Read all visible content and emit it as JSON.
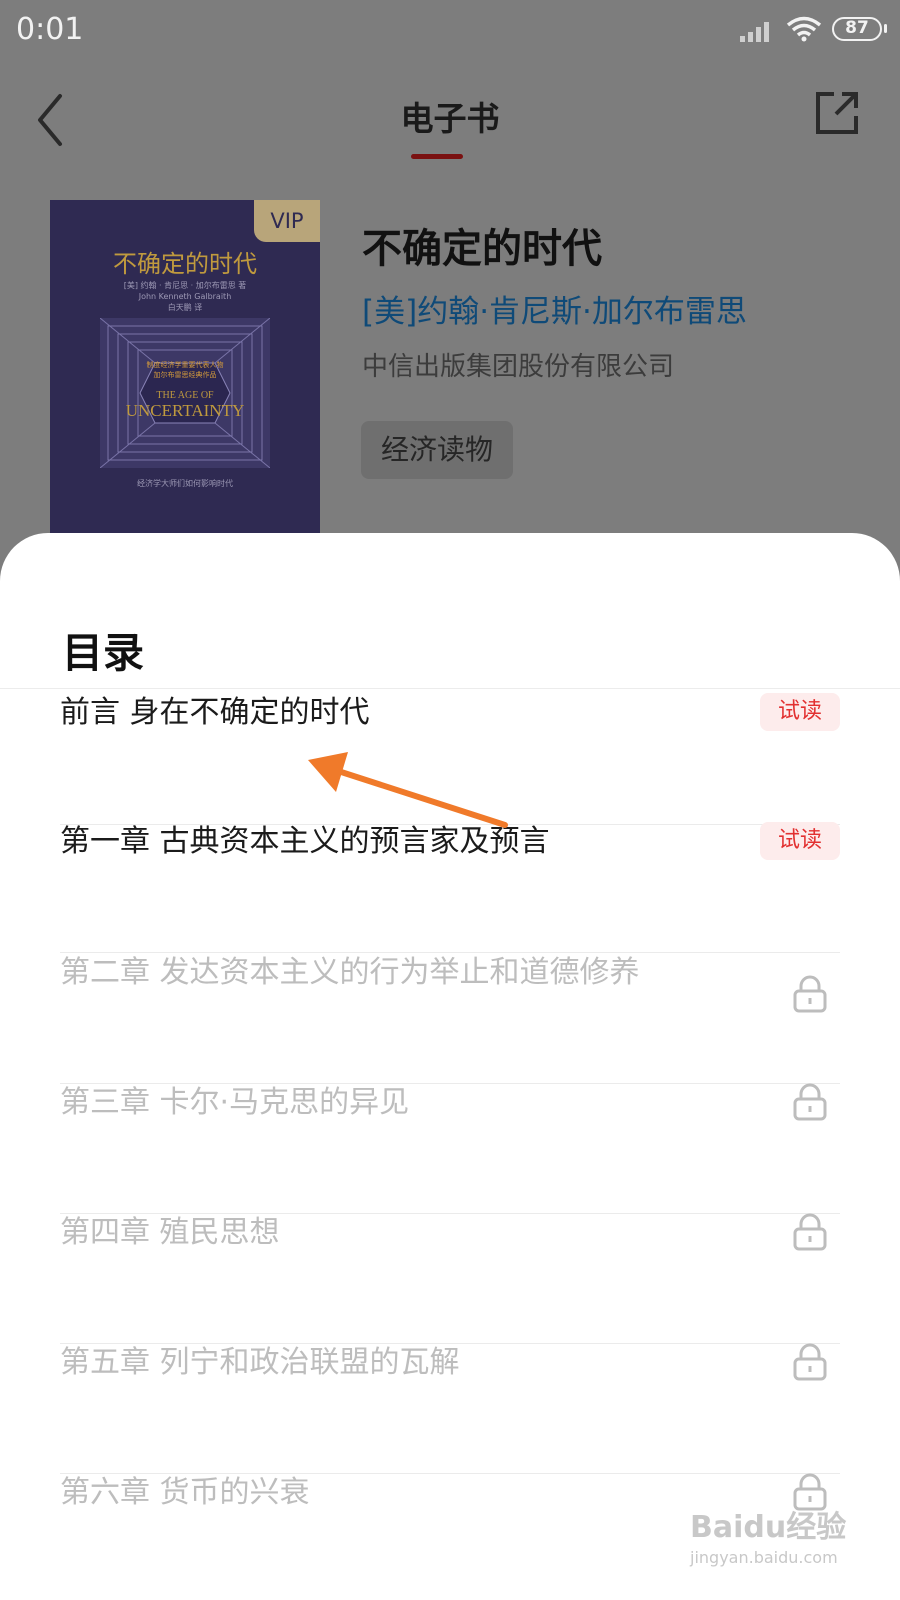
{
  "status_bar": {
    "time": "0:01",
    "battery": "87"
  },
  "header": {
    "title": "电子书"
  },
  "book": {
    "title": "不确定的时代",
    "author": "[美]约翰·肯尼斯·加尔布雷思",
    "publisher": "中信出版集团股份有限公司",
    "tag": "经济读物",
    "cover": {
      "vip_badge": "VIP",
      "title": "不确定的时代",
      "author_line": "[美] 约翰 · 肯尼思 · 加尔布雷思 著",
      "author_en": "John Kenneth Galbraith",
      "translator": "白天鹏 译",
      "tagline_1": "制度经济学重要代表人物",
      "tagline_2": "加尔布雷思经典作品",
      "english_title_1": "THE AGE OF",
      "english_title_2": "UNCERTAINTY",
      "footer": "经济学大师们如何影响时代"
    }
  },
  "toc": {
    "title": "目录",
    "trial_label": "试读",
    "items": [
      {
        "label": "前言 身在不确定的时代",
        "state": "trial"
      },
      {
        "label": "第一章 古典资本主义的预言家及预言",
        "state": "trial"
      },
      {
        "label": "第二章 发达资本主义的行为举止和道德修养",
        "state": "locked"
      },
      {
        "label": "第三章 卡尔·马克思的异见",
        "state": "locked"
      },
      {
        "label": "第四章 殖民思想",
        "state": "locked"
      },
      {
        "label": "第五章 列宁和政治联盟的瓦解",
        "state": "locked"
      },
      {
        "label": "第六章 货币的兴衰",
        "state": "locked"
      }
    ]
  },
  "watermark": {
    "logo": "Baidu经验",
    "url": "jingyan.baidu.com"
  },
  "colors": {
    "accent": "#e23030",
    "author_link": "#0f4a78",
    "overlay": "#7d7d7d",
    "arrow": "#f07a2a"
  }
}
